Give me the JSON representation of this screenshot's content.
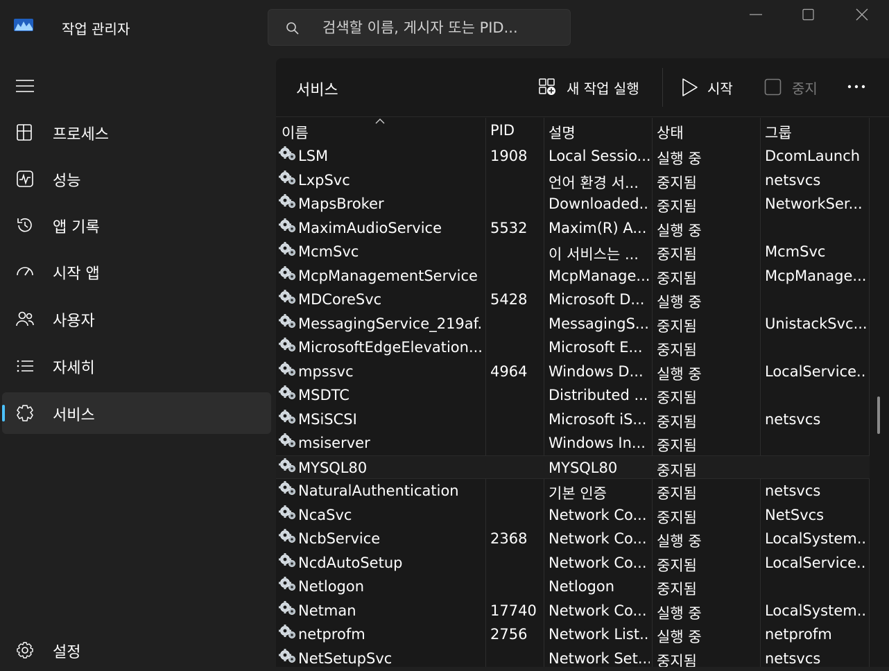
{
  "app": {
    "title": "작업 관리자"
  },
  "search": {
    "placeholder": "검색할 이름, 게시자 또는 PID..."
  },
  "sidebar": {
    "items": [
      {
        "label": "프로세스",
        "icon": "processes-icon"
      },
      {
        "label": "성능",
        "icon": "performance-icon"
      },
      {
        "label": "앱 기록",
        "icon": "history-icon"
      },
      {
        "label": "시작 앱",
        "icon": "startup-icon"
      },
      {
        "label": "사용자",
        "icon": "users-icon"
      },
      {
        "label": "자세히",
        "icon": "details-icon"
      },
      {
        "label": "서비스",
        "icon": "services-icon",
        "active": true
      }
    ],
    "settings_label": "설정"
  },
  "toolbar": {
    "page_title": "서비스",
    "new_task_label": "새 작업 실행",
    "start_label": "시작",
    "stop_label": "중지"
  },
  "table": {
    "columns": {
      "name": "이름",
      "pid": "PID",
      "desc": "설명",
      "status": "상태",
      "group": "그룹"
    },
    "rows": [
      {
        "name": "LSM",
        "pid": "1908",
        "desc": "Local Sessio...",
        "status": "실행 중",
        "group": "DcomLaunch"
      },
      {
        "name": "LxpSvc",
        "pid": "",
        "desc": "언어 환경 서...",
        "status": "중지됨",
        "group": "netsvcs"
      },
      {
        "name": "MapsBroker",
        "pid": "",
        "desc": "Downloaded...",
        "status": "중지됨",
        "group": "NetworkSer..."
      },
      {
        "name": "MaximAudioService",
        "pid": "5532",
        "desc": "Maxim(R) A...",
        "status": "실행 중",
        "group": ""
      },
      {
        "name": "McmSvc",
        "pid": "",
        "desc": "이 서비스는 ...",
        "status": "중지됨",
        "group": "McmSvc"
      },
      {
        "name": "McpManagementService",
        "pid": "",
        "desc": "McpManage...",
        "status": "중지됨",
        "group": "McpManage..."
      },
      {
        "name": "MDCoreSvc",
        "pid": "5428",
        "desc": "Microsoft D...",
        "status": "실행 중",
        "group": ""
      },
      {
        "name": "MessagingService_219af...",
        "pid": "",
        "desc": "MessagingS...",
        "status": "중지됨",
        "group": "UnistackSvc..."
      },
      {
        "name": "MicrosoftEdgeElevation...",
        "pid": "",
        "desc": "Microsoft E...",
        "status": "중지됨",
        "group": ""
      },
      {
        "name": "mpssvc",
        "pid": "4964",
        "desc": "Windows D...",
        "status": "실행 중",
        "group": "LocalService..."
      },
      {
        "name": "MSDTC",
        "pid": "",
        "desc": "Distributed ...",
        "status": "중지됨",
        "group": ""
      },
      {
        "name": "MSiSCSI",
        "pid": "",
        "desc": "Microsoft iS...",
        "status": "중지됨",
        "group": "netsvcs"
      },
      {
        "name": "msiserver",
        "pid": "",
        "desc": "Windows In...",
        "status": "중지됨",
        "group": ""
      },
      {
        "name": "MYSQL80",
        "pid": "",
        "desc": "MYSQL80",
        "status": "중지됨",
        "group": ""
      },
      {
        "name": "NaturalAuthentication",
        "pid": "",
        "desc": "기본 인증",
        "status": "중지됨",
        "group": "netsvcs"
      },
      {
        "name": "NcaSvc",
        "pid": "",
        "desc": "Network Co...",
        "status": "중지됨",
        "group": "NetSvcs"
      },
      {
        "name": "NcbService",
        "pid": "2368",
        "desc": "Network Co...",
        "status": "실행 중",
        "group": "LocalSystem..."
      },
      {
        "name": "NcdAutoSetup",
        "pid": "",
        "desc": "Network Co...",
        "status": "중지됨",
        "group": "LocalService..."
      },
      {
        "name": "Netlogon",
        "pid": "",
        "desc": "Netlogon",
        "status": "중지됨",
        "group": ""
      },
      {
        "name": "Netman",
        "pid": "17740",
        "desc": "Network Co...",
        "status": "실행 중",
        "group": "LocalSystem..."
      },
      {
        "name": "netprofm",
        "pid": "2756",
        "desc": "Network List...",
        "status": "실행 중",
        "group": "netprofm"
      },
      {
        "name": "NetSetupSvc",
        "pid": "",
        "desc": "Network Set...",
        "status": "중지됨",
        "group": "netsvcs"
      }
    ]
  },
  "colors": {
    "background": "#202020",
    "panel": "#191919",
    "accent": "#4cc2ff",
    "text": "#ffffff",
    "disabled": "#7a7a7a"
  }
}
